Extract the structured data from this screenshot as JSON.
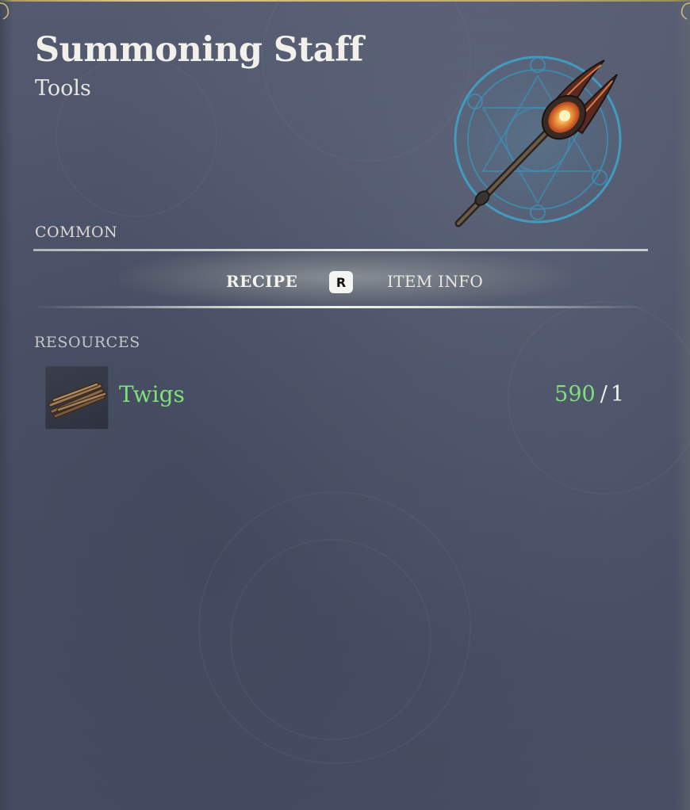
{
  "item": {
    "name": "Summoning Staff",
    "category": "Tools",
    "rarity": "COMMON",
    "icon": "summoning-staff-icon"
  },
  "tabs": {
    "recipe": "RECIPE",
    "key_hint": "R",
    "item_info": "ITEM INFO",
    "active": "RECIPE"
  },
  "resources": {
    "heading": "RESOURCES",
    "items": [
      {
        "name": "Twigs",
        "have": "590",
        "separator": "/",
        "need": "1",
        "icon": "twigs-icon"
      }
    ]
  },
  "colors": {
    "panel": "#4b5166",
    "available": "#7fe07a",
    "text": "#f2f0ea",
    "frame_gold": "#d9c98a"
  }
}
